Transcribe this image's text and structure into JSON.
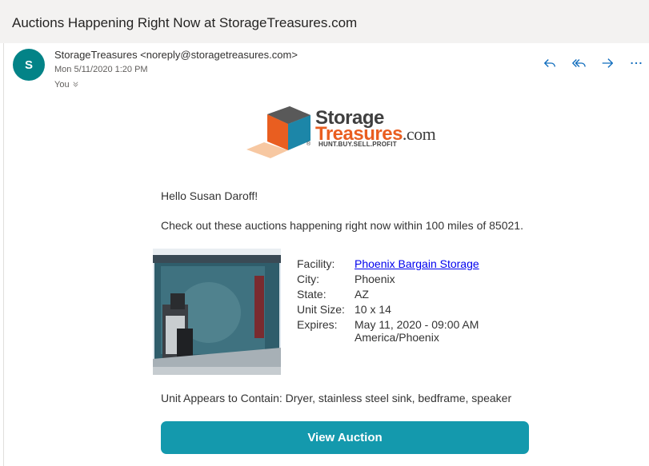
{
  "email": {
    "subject": "Auctions Happening Right Now at StorageTreasures.com",
    "avatar_initial": "S",
    "sender": "StorageTreasures <noreply@storagetreasures.com>",
    "date": "Mon 5/11/2020 1:20 PM",
    "to": "You"
  },
  "actions": {
    "reply": "reply-icon",
    "reply_all": "reply-all-icon",
    "forward": "forward-icon",
    "more": "more-icon"
  },
  "logo": {
    "line1": "Storage",
    "line2": "Treasures",
    "dotcom": ".com",
    "reg": "®",
    "tagline": "HUNT.BUY.SELL.PROFIT"
  },
  "body": {
    "greeting": "Hello Susan Daroff!",
    "intro": "Check out these auctions happening right now within 100 miles of 85021.",
    "details": {
      "facility_label": "Facility:",
      "facility_value": "Phoenix Bargain Storage",
      "city_label": "City:",
      "city_value": "Phoenix",
      "state_label": "State:",
      "state_value": "AZ",
      "size_label": "Unit Size:",
      "size_value": "10 x 14",
      "expires_label": "Expires:",
      "expires_value": "May 11, 2020 - 09:00 AM",
      "expires_tz": "America/Phoenix"
    },
    "contains": "Unit Appears to Contain: Dryer, stainless steel sink, bedframe, speaker",
    "button": "View Auction"
  },
  "colors": {
    "avatar": "#038387",
    "accent_icons": "#0f6cbd",
    "button": "#1499ad",
    "logo_orange": "#e95e20"
  }
}
